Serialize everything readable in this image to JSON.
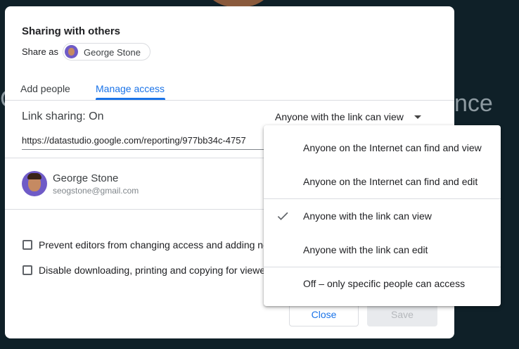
{
  "background": {
    "left_text": "C",
    "right_text": "nce"
  },
  "dialog": {
    "title": "Sharing with others",
    "share_as_label": "Share as",
    "share_as_name": "George Stone",
    "tabs": [
      {
        "label": "Add people",
        "active": false
      },
      {
        "label": "Manage access",
        "active": true
      }
    ],
    "link_sharing_label": "Link sharing: On",
    "link_sharing_selected": "Anyone with the link can view",
    "url": "https://datastudio.google.com/reporting/977bb34c-4757",
    "person": {
      "name": "George Stone",
      "email": "seogstone@gmail.com"
    },
    "options": [
      {
        "label": "Prevent editors from changing access and adding new people",
        "checked": false
      },
      {
        "label": "Disable downloading, printing and copying for viewers",
        "checked": false
      }
    ],
    "close_label": "Close",
    "save_label": "Save"
  },
  "dropdown": {
    "items": [
      {
        "label": "Anyone on the Internet can find and view",
        "selected": false
      },
      {
        "label": "Anyone on the Internet can find and edit",
        "selected": false
      },
      {
        "label": "Anyone with the link can view",
        "selected": true
      },
      {
        "label": "Anyone with the link can edit",
        "selected": false
      },
      {
        "label": "Off – only specific people can access",
        "selected": false
      }
    ]
  },
  "colors": {
    "accent": "#1a73e8",
    "backdrop": "#0f2028",
    "text": "#202124",
    "divider": "#dadce0"
  }
}
